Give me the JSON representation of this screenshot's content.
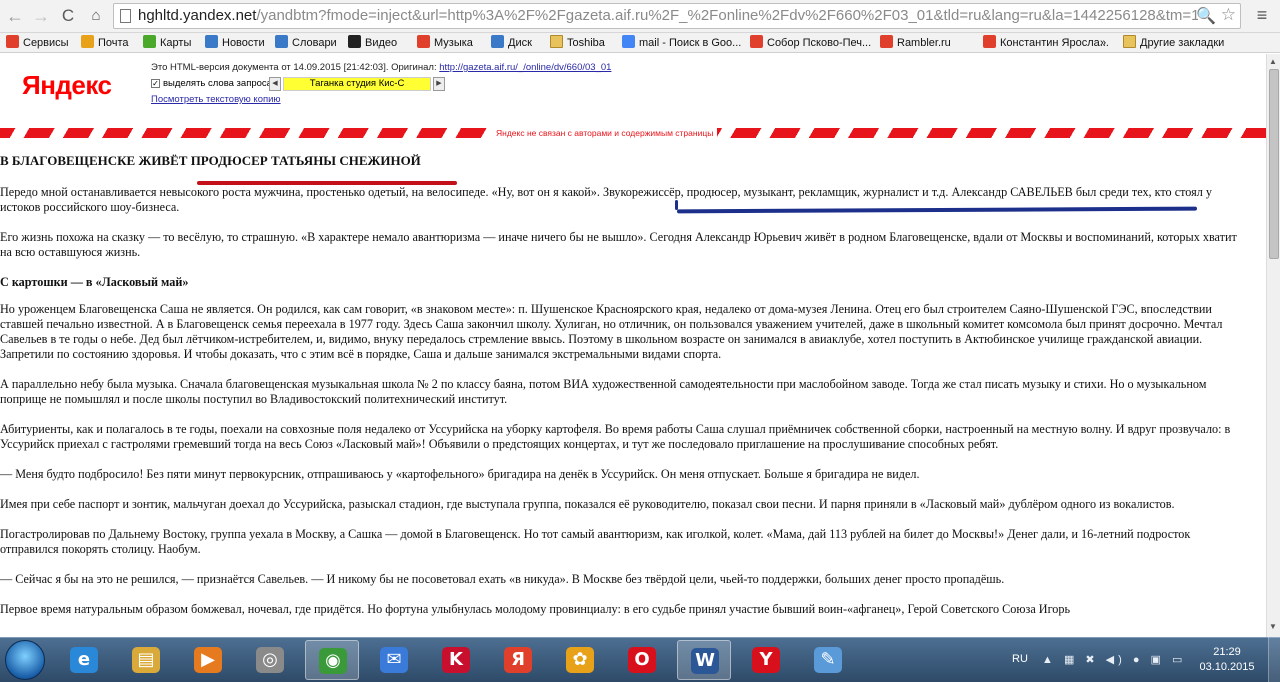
{
  "browser": {
    "url_host": "hghltd.yandex.net",
    "url_rest": "/yandbtm?fmode=inject&url=http%3A%2F%2Fgazeta.aif.ru%2F_%2Fonline%2Fdv%2F660%2F03_01&tld=ru&lang=ru&la=1442256128&tm=1"
  },
  "bookmarks": [
    {
      "label": "Сервисы",
      "icon": "apps-icon",
      "color": "#e0402b"
    },
    {
      "label": "Почта",
      "icon": "mail-icon",
      "color": "#e8a21a"
    },
    {
      "label": "Карты",
      "icon": "maps-icon",
      "color": "#4aa82a"
    },
    {
      "label": "Новости",
      "icon": "news-icon",
      "color": "#3a78c8"
    },
    {
      "label": "Словари",
      "icon": "dictionary-icon",
      "color": "#3a78c8"
    },
    {
      "label": "Видео",
      "icon": "video-icon",
      "color": "#222222"
    },
    {
      "label": "Музыка",
      "icon": "music-icon",
      "color": "#e0402b"
    },
    {
      "label": "Диск",
      "icon": "disk-icon",
      "color": "#3a78c8"
    },
    {
      "label": "Toshiba",
      "icon": "folder-icon",
      "color": "#e8c25a"
    },
    {
      "label": "mail - Поиск в Goo...",
      "icon": "google-icon",
      "color": "#4285f4"
    },
    {
      "label": "Собор Псково-Печ...",
      "icon": "yandex-icon",
      "color": "#e0402b"
    },
    {
      "label": "Rambler.ru",
      "icon": "yandex-icon",
      "color": "#e0402b"
    },
    {
      "label": "Константин Яросла...",
      "icon": "yandex-icon",
      "color": "#e0402b"
    },
    {
      "label": "»",
      "icon": "",
      "color": ""
    },
    {
      "label": "Другие закладки",
      "icon": "folder-icon",
      "color": "#e8c25a"
    }
  ],
  "yandex": {
    "logo": "Яндекс",
    "info_text": "Это HTML-версия документа от 14.09.2015 [21:42:03]. Оригинал: ",
    "original_link": "http://gazeta.aif.ru/_/online/dv/660/03_01",
    "highlight_label": "выделять слова запроса:",
    "highlight_term": "Таганка студия Кис-С",
    "text_copy_link": "Посмотреть текстовую копию",
    "disclaimer": "Яндекс не связан с авторами и содержимым страницы"
  },
  "article": {
    "title": "В БЛАГОВЕЩЕНСКЕ ЖИВЁТ ПРОДЮСЕР ТАТЬЯНЫ СНЕЖИНОЙ",
    "subheading": "С картошки — в «Ласковый май»",
    "paragraphs": [
      "Передо мной останавливается невысокого роста мужчина, простенько одетый, на велосипеде. «Ну, вот он я какой». Звукорежиссёр, продюсер, музыкант, рекламщик, журналист и т.д. Александр САВЕЛЬЕВ был среди тех, кто стоял у истоков российского шоу-бизнеса.",
      "Его жизнь похожа на сказку — то весёлую, то страшную. «В характере немало авантюризма — иначе ничего бы не вышло». Сегодня Александр Юрьевич живёт в родном Благовещенске, вдали от Москвы и воспоминаний, которых хватит на всю оставшуюся жизнь.",
      "Но уроженцем Благовещенска Саша не является. Он родился, как сам говорит, «в знаковом месте»: п. Шушенское Красноярского края, недалеко от дома-музея Ленина. Отец его был строителем Саяно-Шушенской ГЭС, впоследствии ставшей печально известной. А в Благовещенск семья переехала в 1977 году. Здесь Саша закончил школу. Хулиган, но отличник, он пользовался уважением учителей, даже в школьный комитет комсомола был принят досрочно. Мечтал Савельев в те годы о небе. Дед был лётчиком-истребителем, и, видимо, внуку передалось стремление ввысь. Поэтому в школьном возрасте он занимался в авиаклубе, хотел поступить в Актюбинское училище гражданской авиации. Запретили по состоянию здоровья. И чтобы доказать, что с этим всё в порядке, Саша и дальше занимался экстремальными видами спорта.",
      "А параллельно небу была музыка. Сначала благовещенская музыкальная школа № 2 по классу баяна, потом ВИА художественной самодеятельности при маслобойном заводе. Тогда же стал писать музыку и стихи. Но о музыкальном поприще не помышлял и после школы поступил во Владивостокский политехнический институт.",
      "Абитуриенты, как и полагалось в те годы, поехали на совхозные поля недалеко от Уссурийска на уборку картофеля. Во время работы Саша слушал приёмничек собственной сборки, настроенный на местную волну. И вдруг прозвучало: в Уссурийск приехал с гастролями гремевший тогда на весь Союз «Ласковый май»! Объявили о предстоящих концертах, и тут же последовало приглашение на прослушивание способных ребят.",
      "— Меня будто подбросило! Без пяти минут первокурсник, отпрашиваюсь у «картофельного» бригадира на денёк в Уссурийск. Он меня отпускает. Больше я бригадира не видел.",
      "Имея при себе паспорт и зонтик, мальчуган доехал до Уссурийска, разыскал стадион, где выступала группа, показался её руководителю, показал свои песни. И парня приняли в «Ласковый май» дублёром одного из вокалистов.",
      "Погастролировав по Дальнему Востоку, группа уехала в Москву, а Сашка — домой в Благовещенск. Но тот самый авантюризм, как иголкой, колет. «Мама, дай 113 рублей на билет до Москвы!» Денег дали, и 16-летний подросток отправился покорять столицу. Наобум.",
      "— Сейчас я бы на это не решился, — признаётся Савельев. — И никому бы не посоветовал ехать «в никуда». В Москве без твёрдой цели, чьей-то поддержки, больших денег просто пропадёшь.",
      "Первое время натуральным образом бомжевал, ночевал, где придётся. Но фортуна улыбнулась молодому провинциалу: в его судьбе принял участие бывший воин-«афганец», Герой Советского Союза Игорь"
    ]
  },
  "taskbar": {
    "apps": [
      {
        "name": "internet-explorer",
        "glyph": "e",
        "color": "#2a88d8"
      },
      {
        "name": "file-explorer",
        "glyph": "▤",
        "color": "#d9a93a"
      },
      {
        "name": "media-player",
        "glyph": "▶",
        "color": "#e67a1e"
      },
      {
        "name": "cd-burner",
        "glyph": "◎",
        "color": "#8a8a8a"
      },
      {
        "name": "chrome",
        "glyph": "◉",
        "color": "#3a9a3a"
      },
      {
        "name": "mail",
        "glyph": "✉",
        "color": "#3a7ad8"
      },
      {
        "name": "kaspersky",
        "glyph": "K",
        "color": "#c8102e"
      },
      {
        "name": "yandex",
        "glyph": "Я",
        "color": "#e0402b"
      },
      {
        "name": "icq",
        "glyph": "✿",
        "color": "#e8a21a"
      },
      {
        "name": "opera",
        "glyph": "O",
        "color": "#d8101c"
      },
      {
        "name": "word",
        "glyph": "W",
        "color": "#2b5797"
      },
      {
        "name": "yandex-browser",
        "glyph": "Y",
        "color": "#d8101c"
      },
      {
        "name": "paint",
        "glyph": "✎",
        "color": "#5a9ad8"
      }
    ],
    "language": "RU",
    "time": "21:29",
    "date": "03.10.2015"
  }
}
